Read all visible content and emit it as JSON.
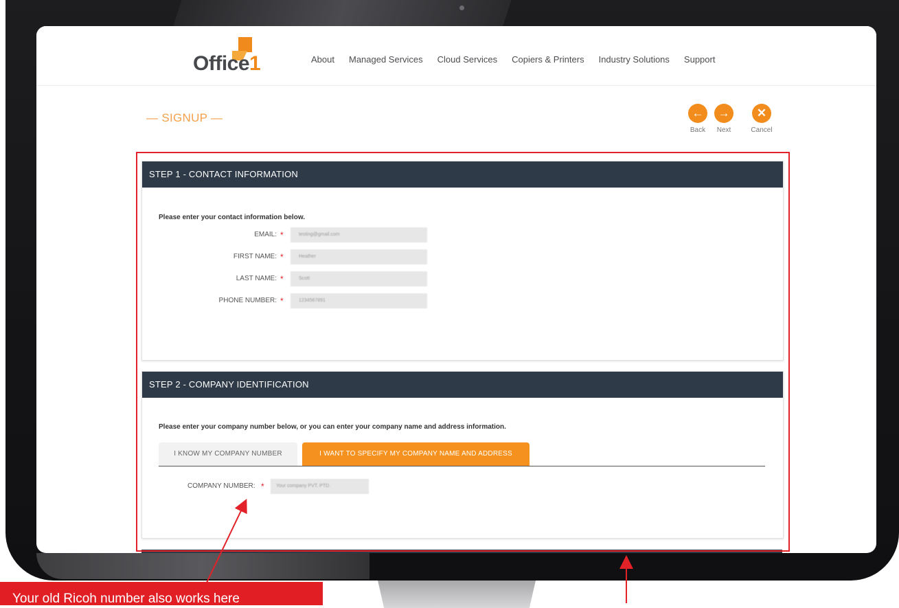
{
  "nav": {
    "logo_text_main": "Office",
    "logo_text_accent": "1",
    "items": [
      "About",
      "Managed Services",
      "Cloud Services",
      "Copiers & Printers",
      "Industry Solutions",
      "Support"
    ]
  },
  "page": {
    "title": "— SIGNUP —",
    "controls": {
      "back": {
        "label": "Back",
        "icon": "arrow-left-icon"
      },
      "next": {
        "label": "Next",
        "icon": "arrow-right-icon"
      },
      "cancel": {
        "label": "Cancel",
        "icon": "close-icon"
      }
    },
    "accent_color": "#f28c1c",
    "panel_header_color": "#2e3a47"
  },
  "step1": {
    "header": "STEP 1 - CONTACT INFORMATION",
    "intro": "Please enter your contact information below.",
    "fields": [
      {
        "label": "EMAIL:",
        "value": "testing@gmail.com"
      },
      {
        "label": "FIRST NAME:",
        "value": "Heather"
      },
      {
        "label": "LAST NAME:",
        "value": "Scott"
      },
      {
        "label": "PHONE NUMBER:",
        "value": "1234567891"
      }
    ]
  },
  "step2": {
    "header": "STEP 2 - COMPANY IDENTIFICATION",
    "intro": "Please enter your company number below, or you can enter your company name and address information.",
    "tabs": [
      "I KNOW MY COMPANY NUMBER",
      "I WANT TO SPECIFY MY COMPANY NAME AND ADDRESS"
    ],
    "company_number_label": "COMPANY NUMBER:",
    "company_number_placeholder": "Your company PVT. PTD."
  },
  "annotation": {
    "callout_text": "Your old Ricoh number also works here",
    "highlight_color": "#e32128"
  }
}
